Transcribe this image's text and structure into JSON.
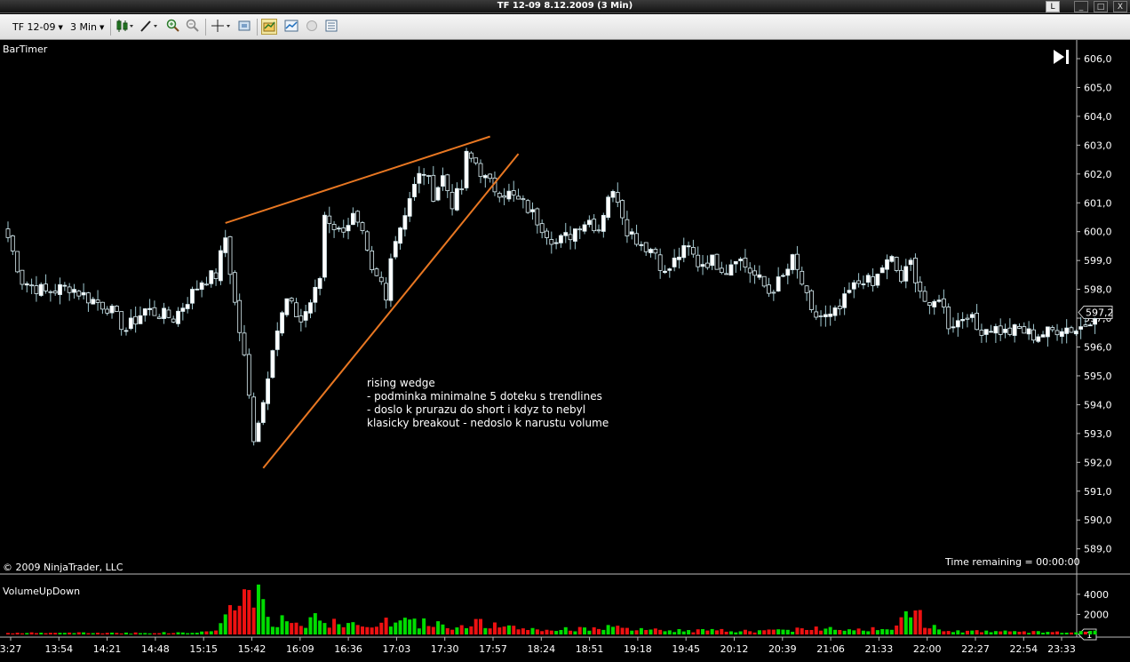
{
  "window": {
    "title": "TF 12-09  8.12.2009 (3 Min)",
    "buttons": [
      "L",
      "_",
      "□",
      "X"
    ]
  },
  "toolbar": {
    "instrument": "TF 12-09",
    "interval": "3 Min"
  },
  "panels": {
    "price_indicator": "BarTimer",
    "volume_indicator": "VolumeUpDown"
  },
  "copyright": "© 2009 NinjaTrader, LLC",
  "time_remaining": "Time remaining = 00:00:00",
  "annotation": {
    "lines": [
      "rising wedge",
      "- podminka minimalne 5 doteku s trendlines",
      "- doslo k prurazu do short i kdyz to nebyl",
      "klasicky breakout - nedoslo k narustu volume"
    ]
  },
  "colors": {
    "up_candle": "#ffffff",
    "down_candle": "#000000",
    "candle_outline": "#dff2f7",
    "wick": "#9fc7cf",
    "trendline": "#e87722",
    "volume_up": "#00dd00",
    "volume_down": "#ee1111"
  },
  "chart_data": {
    "type": "candlestick",
    "price_axis": {
      "ticks": [
        "606,0",
        "605,0",
        "604,0",
        "603,0",
        "602,0",
        "601,0",
        "600,0",
        "599,0",
        "598,0",
        "597,0",
        "596,0",
        "595,0",
        "594,0",
        "593,0",
        "592,0",
        "591,0",
        "590,0",
        "589,0"
      ],
      "ylim": [
        588.5,
        606.5
      ],
      "last_price_label": "597,2",
      "last_price": 597.2
    },
    "volume_axis": {
      "ticks": [
        "4000",
        "2000"
      ],
      "ylim": [
        0,
        5500
      ],
      "last_label": "1"
    },
    "time_axis": {
      "ticks": [
        "3:27",
        "13:54",
        "14:21",
        "14:48",
        "15:15",
        "15:42",
        "16:09",
        "16:36",
        "17:03",
        "17:30",
        "17:57",
        "18:24",
        "18:51",
        "19:18",
        "19:45",
        "20:12",
        "20:39",
        "21:06",
        "21:33",
        "22:00",
        "22:27",
        "22:54",
        "23:33"
      ]
    },
    "anchors": [
      {
        "i": 0,
        "c": 599.8
      },
      {
        "i": 3,
        "c": 598.3
      },
      {
        "i": 8,
        "c": 597.9
      },
      {
        "i": 13,
        "c": 598.1
      },
      {
        "i": 17,
        "c": 597.7
      },
      {
        "i": 21,
        "c": 597.4
      },
      {
        "i": 25,
        "c": 596.6
      },
      {
        "i": 29,
        "c": 597.3
      },
      {
        "i": 35,
        "c": 597.0
      },
      {
        "i": 41,
        "c": 598.3
      },
      {
        "i": 44,
        "c": 598.5
      },
      {
        "i": 46,
        "c": 599.8
      },
      {
        "i": 48,
        "c": 597.5
      },
      {
        "i": 50,
        "c": 595.6
      },
      {
        "i": 52,
        "c": 592.9
      },
      {
        "i": 54,
        "c": 594.1
      },
      {
        "i": 56,
        "c": 596.1
      },
      {
        "i": 59,
        "c": 597.6
      },
      {
        "i": 62,
        "c": 596.9
      },
      {
        "i": 65,
        "c": 597.9
      },
      {
        "i": 66,
        "c": 598.4
      },
      {
        "i": 67,
        "c": 600.6
      },
      {
        "i": 70,
        "c": 600.0
      },
      {
        "i": 73,
        "c": 600.5
      },
      {
        "i": 75,
        "c": 599.8
      },
      {
        "i": 77,
        "c": 598.5
      },
      {
        "i": 79,
        "c": 598.2
      },
      {
        "i": 80,
        "c": 597.6
      },
      {
        "i": 81,
        "c": 599.3
      },
      {
        "i": 83,
        "c": 600.2
      },
      {
        "i": 85,
        "c": 601.2
      },
      {
        "i": 87,
        "c": 601.9
      },
      {
        "i": 88,
        "c": 602.1
      },
      {
        "i": 90,
        "c": 601.3
      },
      {
        "i": 92,
        "c": 601.9
      },
      {
        "i": 94,
        "c": 601.0
      },
      {
        "i": 96,
        "c": 601.5
      },
      {
        "i": 97,
        "c": 602.6
      },
      {
        "i": 99,
        "c": 602.4
      },
      {
        "i": 101,
        "c": 601.8
      },
      {
        "i": 103,
        "c": 601.5
      },
      {
        "i": 106,
        "c": 601.3
      },
      {
        "i": 110,
        "c": 600.8
      },
      {
        "i": 113,
        "c": 600.2
      },
      {
        "i": 116,
        "c": 599.6
      },
      {
        "i": 119,
        "c": 599.9
      },
      {
        "i": 121,
        "c": 600.3
      },
      {
        "i": 123,
        "c": 600.4
      },
      {
        "i": 125,
        "c": 600.1
      },
      {
        "i": 127,
        "c": 601.3
      },
      {
        "i": 129,
        "c": 601.2
      },
      {
        "i": 131,
        "c": 600.1
      },
      {
        "i": 134,
        "c": 599.6
      },
      {
        "i": 137,
        "c": 599.3
      },
      {
        "i": 139,
        "c": 598.5
      },
      {
        "i": 142,
        "c": 599.2
      },
      {
        "i": 144,
        "c": 599.4
      },
      {
        "i": 146,
        "c": 598.9
      },
      {
        "i": 149,
        "c": 599.0
      },
      {
        "i": 152,
        "c": 598.7
      },
      {
        "i": 154,
        "c": 599.2
      },
      {
        "i": 156,
        "c": 598.8
      },
      {
        "i": 159,
        "c": 598.3
      },
      {
        "i": 161,
        "c": 597.9
      },
      {
        "i": 164,
        "c": 598.4
      },
      {
        "i": 166,
        "c": 599.0
      },
      {
        "i": 168,
        "c": 598.2
      },
      {
        "i": 170,
        "c": 597.1
      },
      {
        "i": 174,
        "c": 597.0
      },
      {
        "i": 176,
        "c": 597.3
      },
      {
        "i": 178,
        "c": 597.9
      },
      {
        "i": 181,
        "c": 598.4
      },
      {
        "i": 183,
        "c": 598.1
      },
      {
        "i": 185,
        "c": 598.8
      },
      {
        "i": 187,
        "c": 599.0
      },
      {
        "i": 189,
        "c": 598.3
      },
      {
        "i": 191,
        "c": 598.9
      },
      {
        "i": 193,
        "c": 598.0
      },
      {
        "i": 195,
        "c": 597.2
      },
      {
        "i": 197,
        "c": 597.8
      },
      {
        "i": 199,
        "c": 596.8
      },
      {
        "i": 201,
        "c": 596.9
      },
      {
        "i": 203,
        "c": 597.2
      },
      {
        "i": 205,
        "c": 596.6
      },
      {
        "i": 208,
        "c": 596.7
      },
      {
        "i": 211,
        "c": 596.5
      },
      {
        "i": 214,
        "c": 596.6
      },
      {
        "i": 217,
        "c": 596.4
      },
      {
        "i": 220,
        "c": 596.5
      },
      {
        "i": 223,
        "c": 596.7
      },
      {
        "i": 226,
        "c": 596.6
      },
      {
        "i": 228,
        "c": 596.8
      },
      {
        "i": 230,
        "c": 597.2
      }
    ],
    "volume_profile": [
      {
        "i": 0,
        "v": 150
      },
      {
        "i": 40,
        "v": 180
      },
      {
        "i": 44,
        "v": 500
      },
      {
        "i": 47,
        "v": 2400
      },
      {
        "i": 50,
        "v": 3700
      },
      {
        "i": 52,
        "v": 4600
      },
      {
        "i": 54,
        "v": 2600
      },
      {
        "i": 56,
        "v": 1500
      },
      {
        "i": 62,
        "v": 1100
      },
      {
        "i": 66,
        "v": 1800
      },
      {
        "i": 70,
        "v": 900
      },
      {
        "i": 78,
        "v": 1200
      },
      {
        "i": 84,
        "v": 1300
      },
      {
        "i": 95,
        "v": 900
      },
      {
        "i": 100,
        "v": 1200
      },
      {
        "i": 105,
        "v": 700
      },
      {
        "i": 115,
        "v": 450
      },
      {
        "i": 125,
        "v": 750
      },
      {
        "i": 135,
        "v": 450
      },
      {
        "i": 150,
        "v": 400
      },
      {
        "i": 160,
        "v": 350
      },
      {
        "i": 170,
        "v": 650
      },
      {
        "i": 180,
        "v": 600
      },
      {
        "i": 188,
        "v": 700
      },
      {
        "i": 192,
        "v": 3000
      },
      {
        "i": 194,
        "v": 1100
      },
      {
        "i": 200,
        "v": 400
      },
      {
        "i": 215,
        "v": 250
      },
      {
        "i": 230,
        "v": 300
      }
    ],
    "wedge_lines": [
      {
        "from": {
          "i": 46,
          "y": 600.3
        },
        "to": {
          "i": 102,
          "y": 603.3
        }
      },
      {
        "from": {
          "i": 54,
          "y": 591.8
        },
        "to": {
          "i": 108,
          "y": 602.7
        }
      }
    ]
  }
}
